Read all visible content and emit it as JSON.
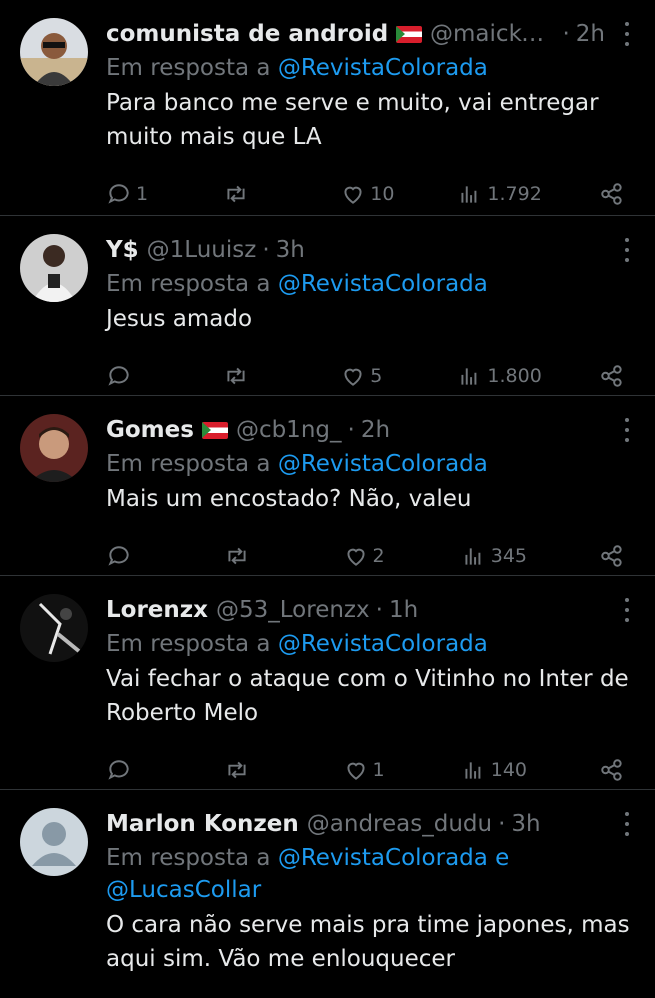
{
  "reply_prefix": "Em resposta a",
  "tweets": [
    {
      "name": "comunista de android",
      "has_flag": true,
      "handle": "@maicke...",
      "dot": "·",
      "time": "2h",
      "mention": "@RevistaColorada",
      "mention_extra": "",
      "text": "Para banco me serve e muito, vai entregar muito mais que LA",
      "replies": "1",
      "retweets": "",
      "likes": "10",
      "views": "1.792"
    },
    {
      "name": "Y$",
      "has_flag": false,
      "handle": "@1Luuisz",
      "dot": "·",
      "time": "3h",
      "mention": "@RevistaColorada",
      "mention_extra": "",
      "text": "Jesus amado",
      "replies": "",
      "retweets": "",
      "likes": "5",
      "views": "1.800"
    },
    {
      "name": "Gomes",
      "has_flag": true,
      "handle": "@cb1ng_",
      "dot": "·",
      "time": "2h",
      "mention": "@RevistaColorada",
      "mention_extra": "",
      "text": "Mais um encostado? Não, valeu",
      "replies": "",
      "retweets": "",
      "likes": "2",
      "views": "345"
    },
    {
      "name": "Lorenzx",
      "has_flag": false,
      "handle": "@53_Lorenzx",
      "dot": "·",
      "time": "1h",
      "mention": "@RevistaColorada",
      "mention_extra": "",
      "text": "Vai fechar o ataque com o Vitinho no Inter de Roberto Melo",
      "replies": "",
      "retweets": "",
      "likes": "1",
      "views": "140"
    },
    {
      "name": "Marlon Konzen",
      "has_flag": false,
      "handle": "@andreas_dudu",
      "dot": "·",
      "time": "3h",
      "mention": "@RevistaColorada e",
      "mention_extra": "@LucasCollar",
      "text": "O cara não serve mais pra time japones, mas aqui sim. Vão me enlouquecer",
      "replies": "",
      "retweets": "",
      "likes": "",
      "views": ""
    }
  ],
  "colors": {
    "background": "#000000",
    "text": "#e7e9ea",
    "muted": "#71767b",
    "link": "#1d9bf0",
    "divider": "#2f3336"
  },
  "icons": [
    "reply-icon",
    "retweet-icon",
    "like-icon",
    "views-icon",
    "share-icon",
    "more-icon"
  ]
}
